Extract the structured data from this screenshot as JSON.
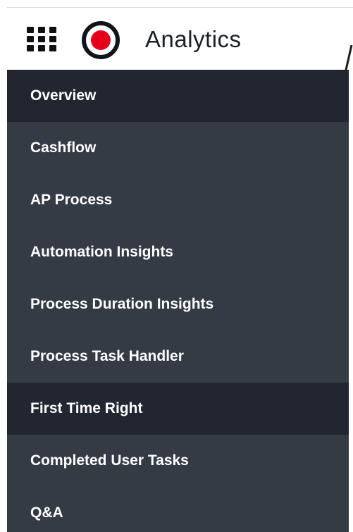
{
  "header": {
    "title": "Analytics",
    "apps_icon": "grid-apps-icon",
    "logo_icon": "record-logo-icon",
    "logo_color": "#e4001b"
  },
  "sidebar": {
    "background_color": "#353b45",
    "active_color": "#212630",
    "items": [
      {
        "label": "Overview",
        "active": true
      },
      {
        "label": "Cashflow",
        "active": false
      },
      {
        "label": "AP Process",
        "active": false
      },
      {
        "label": "Automation Insights",
        "active": false
      },
      {
        "label": "Process Duration Insights",
        "active": false
      },
      {
        "label": "Process Task Handler",
        "active": false
      },
      {
        "label": "First Time Right",
        "active": true
      },
      {
        "label": "Completed User Tasks",
        "active": false
      },
      {
        "label": "Q&A",
        "active": false
      }
    ]
  }
}
